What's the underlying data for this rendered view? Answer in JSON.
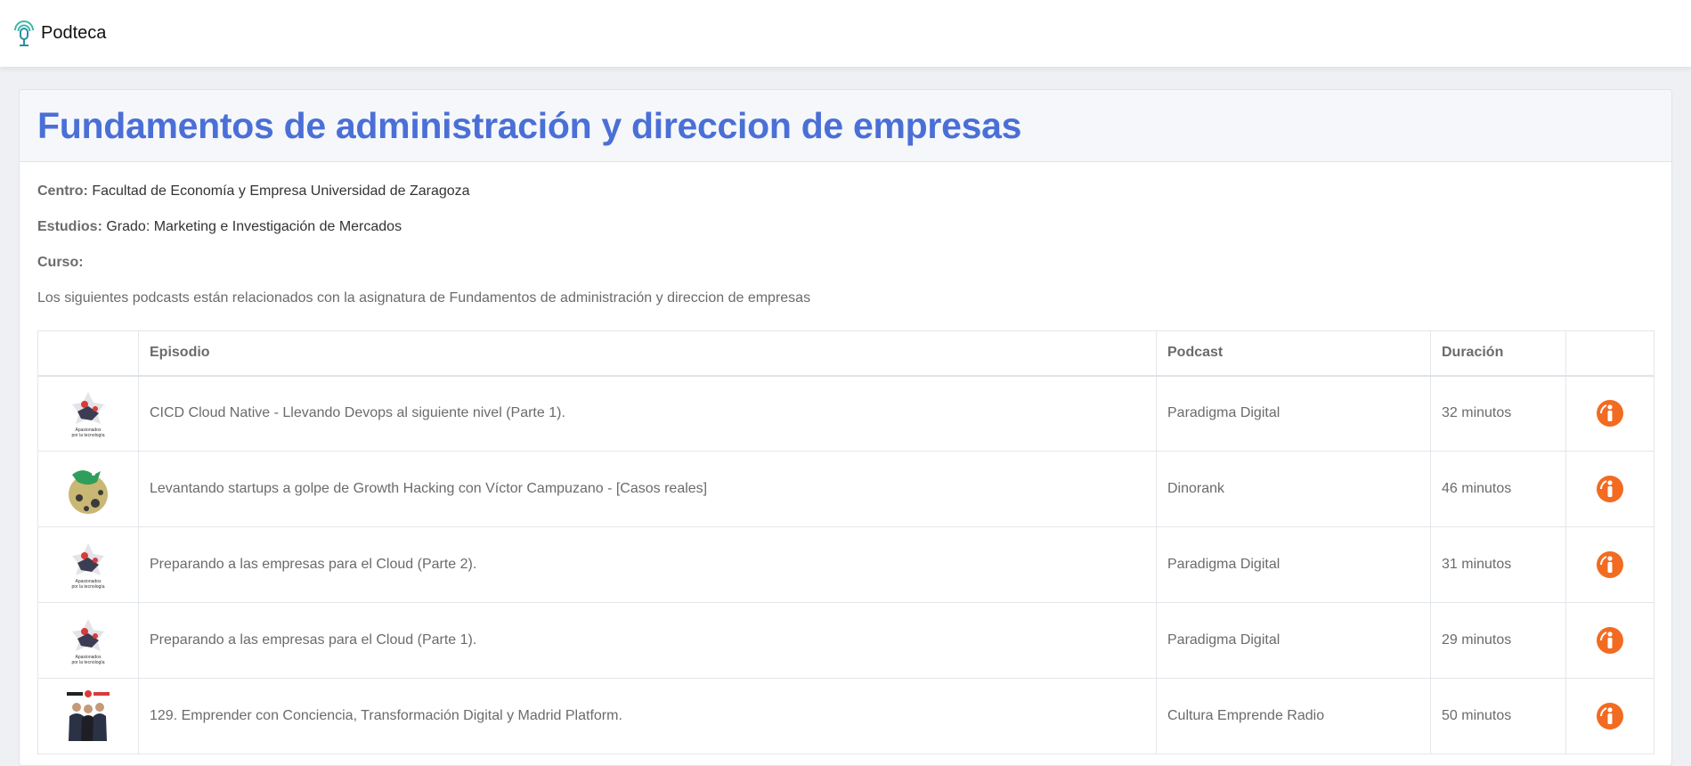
{
  "brand": {
    "name": "Podteca"
  },
  "subject": {
    "title": "Fundamentos de administración y direccion de empresas",
    "centro_label": "Centro:",
    "centro_value": "Facultad de Economía y Empresa Universidad de Zaragoza",
    "estudios_label": "Estudios:",
    "estudios_value": "Grado: Marketing e Investigación de Mercados",
    "curso_label": "Curso:",
    "curso_value": "",
    "description": "Los siguientes podcasts están relacionados con la asignatura de Fundamentos de administración y direccion de empresas"
  },
  "table": {
    "headers": [
      "",
      "Episodio",
      "Podcast",
      "Duración",
      ""
    ],
    "rows": [
      {
        "thumb": "paradigma-thumbnail",
        "episode": "CICD Cloud Native - Llevando Devops al siguiente nivel (Parte 1).",
        "podcast": "Paradigma Digital",
        "duration": "32 minutos"
      },
      {
        "thumb": "dinorank-thumbnail",
        "episode": "Levantando startups a golpe de Growth Hacking con Víctor Campuzano - [Casos reales]",
        "podcast": "Dinorank",
        "duration": "46 minutos"
      },
      {
        "thumb": "paradigma-thumbnail",
        "episode": "Preparando a las empresas para el Cloud (Parte 2).",
        "podcast": "Paradigma Digital",
        "duration": "31 minutos"
      },
      {
        "thumb": "paradigma-thumbnail",
        "episode": "Preparando a las empresas para el Cloud (Parte 1).",
        "podcast": "Paradigma Digital",
        "duration": "29 minutos"
      },
      {
        "thumb": "cultura-emprende-thumbnail",
        "episode": "129. Emprender con Conciencia, Transformación Digital y Madrid Platform.",
        "podcast": "Cultura Emprende Radio",
        "duration": "50 minutos"
      }
    ]
  },
  "thumb_text": {
    "paradigma_line1": "Apasionados",
    "paradigma_line2": "por la tecnología"
  },
  "colors": {
    "accent": "#4a6fd6",
    "info_button": "#f26b21",
    "logo": "#3fb8a8"
  },
  "icons": {
    "brand": "podcast-microphone-icon",
    "action": "ivoox-info-icon"
  }
}
